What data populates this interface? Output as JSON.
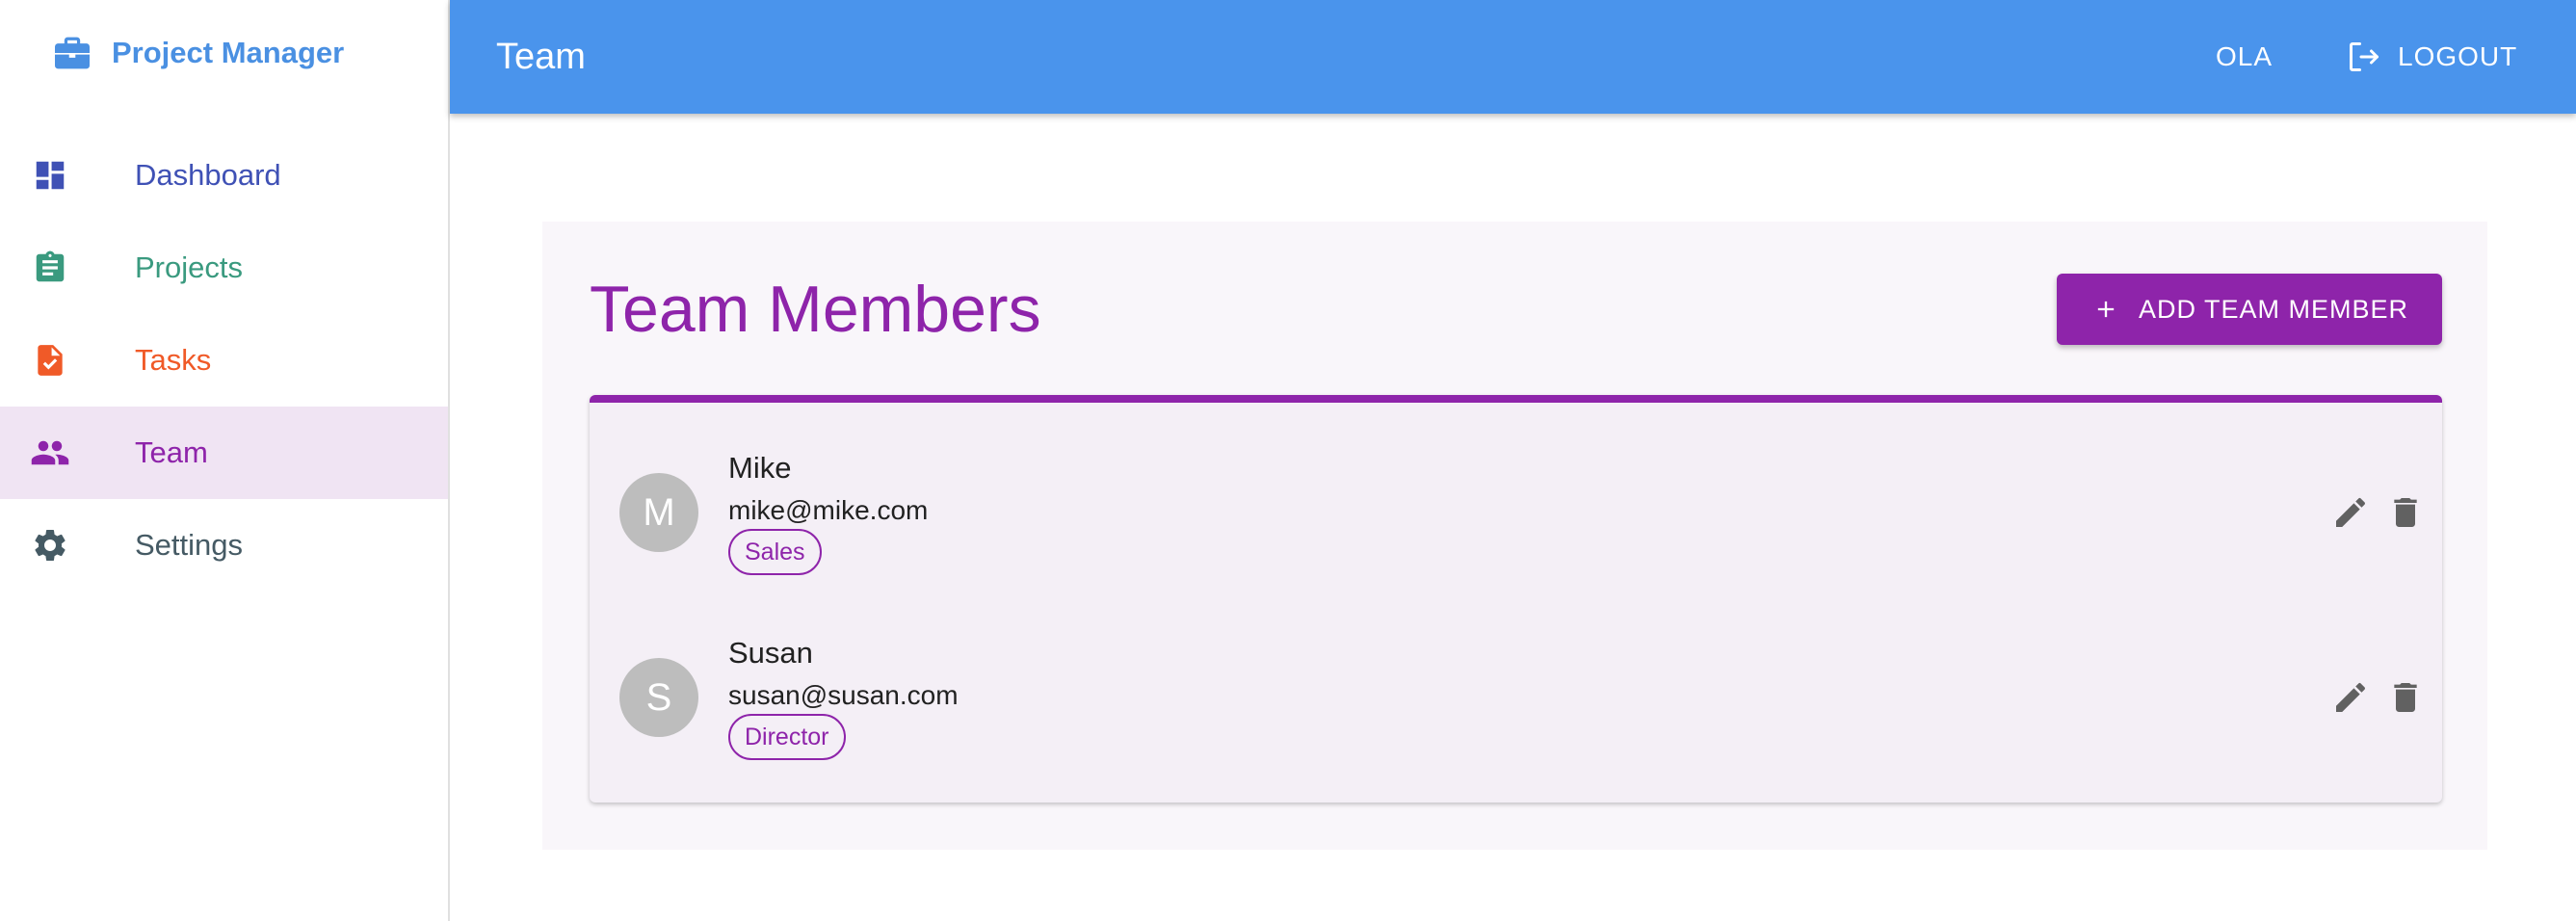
{
  "brand": {
    "name": "Project Manager",
    "icon": "briefcase-icon",
    "color": "#4a90e2"
  },
  "sidebar": {
    "items": [
      {
        "label": "Dashboard",
        "icon": "dashboard-icon",
        "color": "#3f51b5"
      },
      {
        "label": "Projects",
        "icon": "clipboard-icon",
        "color": "#3a9a7f"
      },
      {
        "label": "Tasks",
        "icon": "task-file-icon",
        "color": "#f05a28"
      },
      {
        "label": "Team",
        "icon": "people-icon",
        "color": "#8e24aa",
        "active": true
      },
      {
        "label": "Settings",
        "icon": "gear-icon",
        "color": "#455a64"
      }
    ]
  },
  "header": {
    "title": "Team",
    "user": "OLA",
    "logout_label": "LOGOUT",
    "background": "#4a94ec"
  },
  "main": {
    "title": "Team Members",
    "add_button_label": "ADD TEAM MEMBER",
    "accent": "#8e24aa",
    "members": [
      {
        "initial": "M",
        "name": "Mike",
        "email": "mike@mike.com",
        "role": "Sales"
      },
      {
        "initial": "S",
        "name": "Susan",
        "email": "susan@susan.com",
        "role": "Director"
      }
    ]
  }
}
